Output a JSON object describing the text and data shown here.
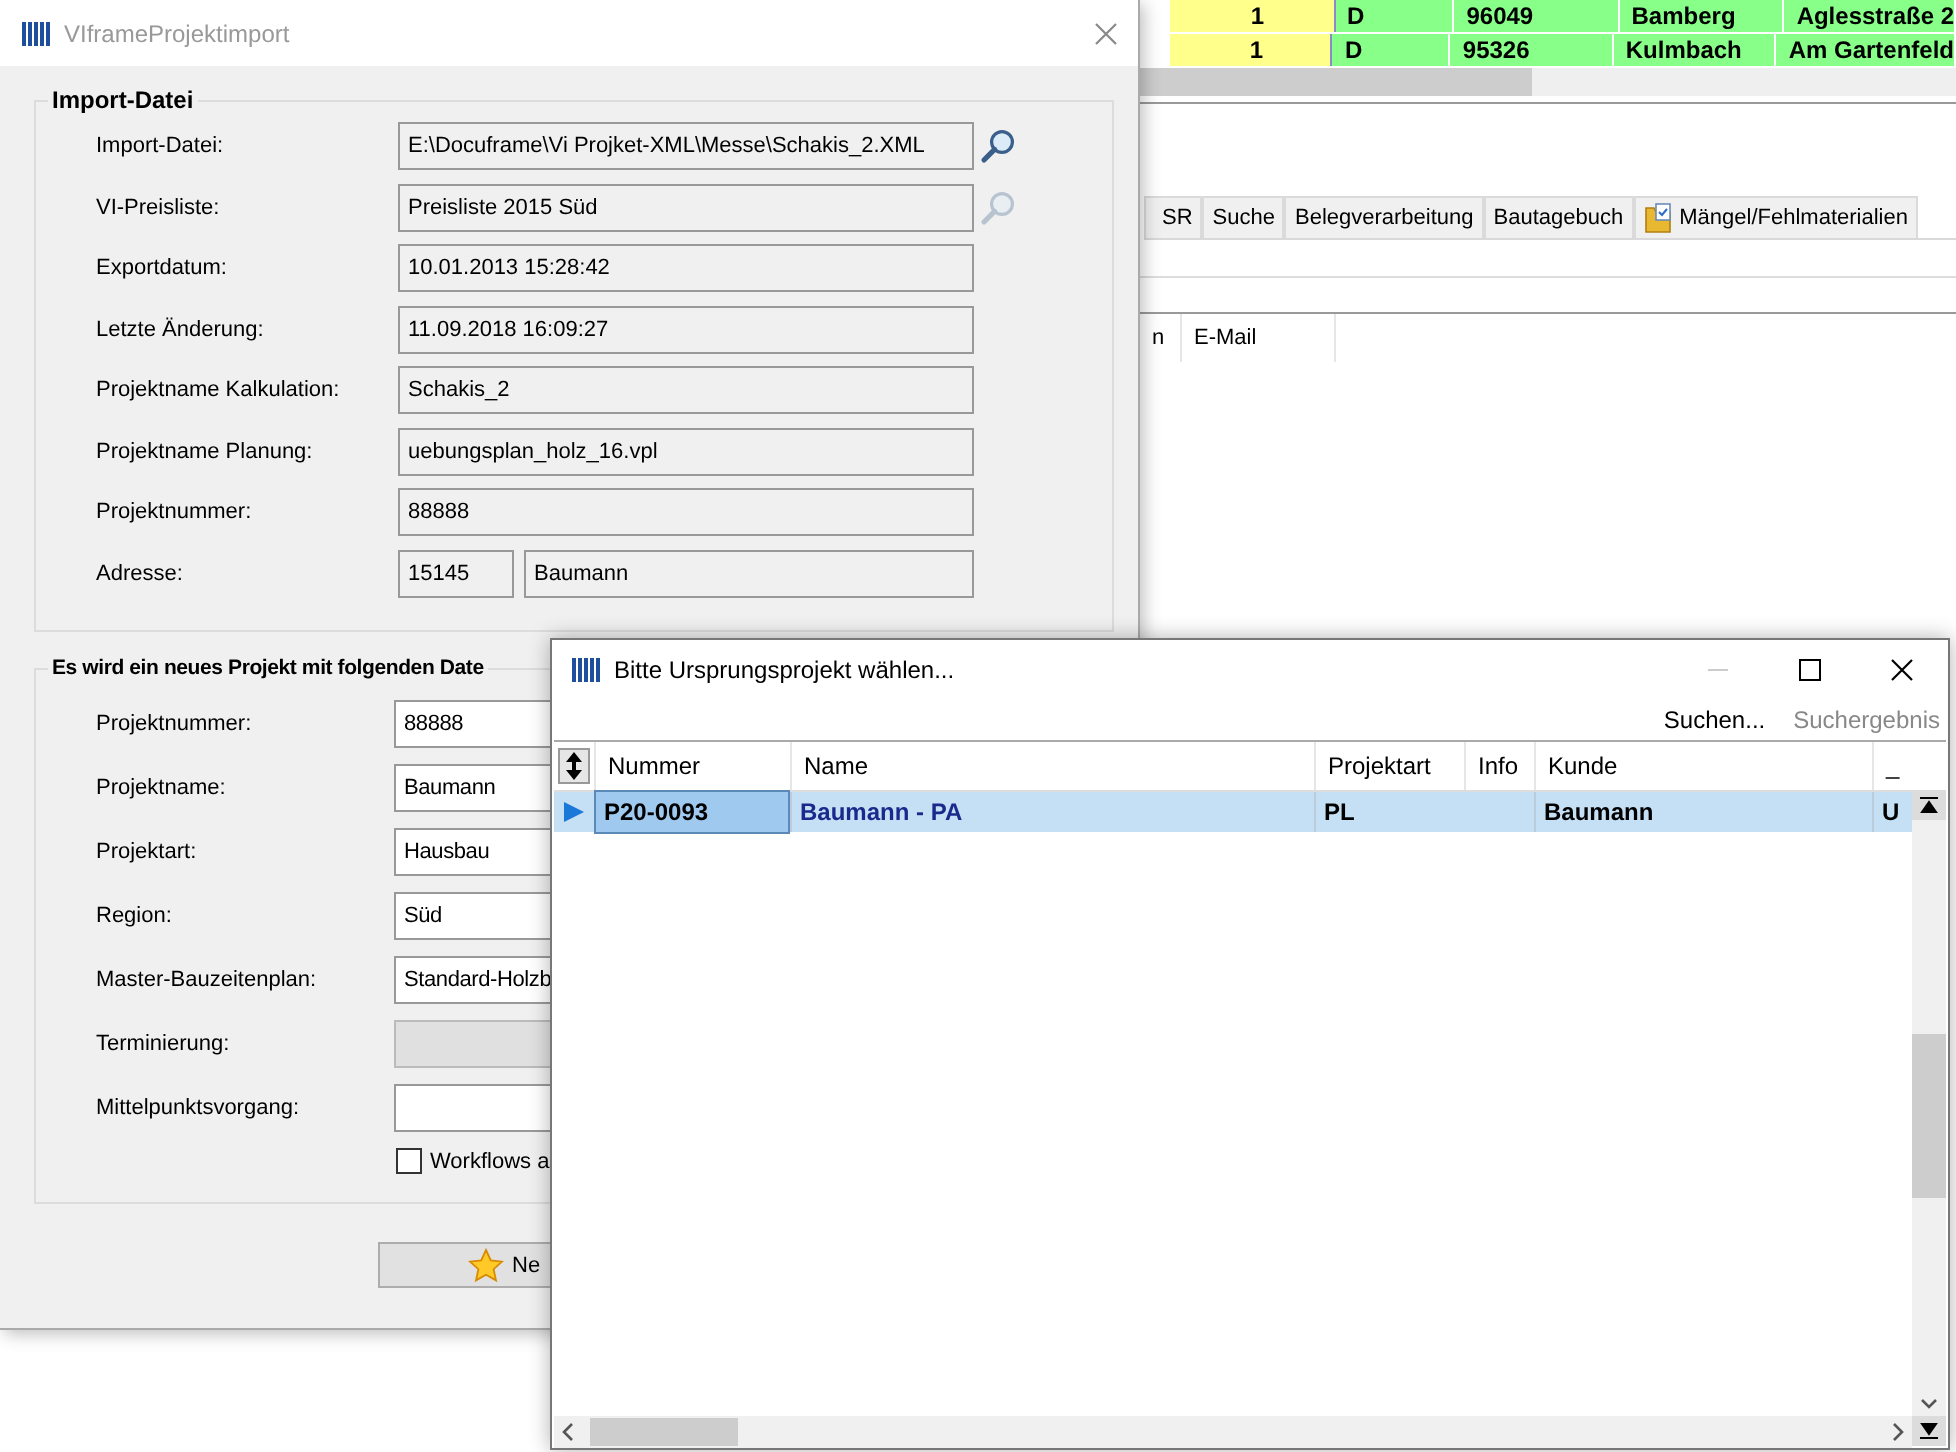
{
  "background_app": {
    "table_rows": [
      {
        "cells": [
          {
            "text": "1",
            "color": "#ffff8c"
          },
          {
            "text": "D",
            "color": "#88ff88"
          },
          {
            "text": "96049",
            "color": "#88ff88"
          },
          {
            "text": "Bamberg",
            "color": "#88ff88"
          },
          {
            "text": "Aglesstraße 2",
            "color": "#88ff88"
          }
        ]
      },
      {
        "cells": [
          {
            "text": "1",
            "color": "#ffff8c"
          },
          {
            "text": "D",
            "color": "#88ff88"
          },
          {
            "text": "95326",
            "color": "#88ff88"
          },
          {
            "text": "Kulmbach",
            "color": "#88ff88"
          },
          {
            "text": "Am Gartenfeld",
            "color": "#88ff88"
          }
        ]
      }
    ],
    "tabs": [
      {
        "label": "SR",
        "kind": "plain"
      },
      {
        "label": "Suche",
        "kind": "plain"
      },
      {
        "label": "Belegverarbeitung",
        "kind": "plain"
      },
      {
        "label": "Bautagebuch",
        "kind": "plain"
      },
      {
        "label": "Mängel/Fehlmaterialien",
        "kind": "icon"
      }
    ],
    "columns": [
      "n",
      "E-Mail"
    ]
  },
  "import_dialog": {
    "title": "VIframeProjektimport",
    "active": false,
    "section_1": {
      "title": "Import-Datei",
      "fields": [
        {
          "label": "Import-Datei:",
          "kind": "text",
          "value": "E:\\Docuframe\\Vi Projket-XML\\Messe\\Schakis_2.XML",
          "search": {
            "disabled": false
          }
        },
        {
          "label": "VI-Preisliste:",
          "kind": "text",
          "value": "Preisliste 2015 Süd",
          "search": {
            "disabled": true
          }
        },
        {
          "label": "Exportdatum:",
          "kind": "text",
          "value": "10.01.2013 15:28:42"
        },
        {
          "label": "Letzte Änderung:",
          "kind": "text",
          "value": "11.09.2018 16:09:27"
        },
        {
          "label": "Projektname Kalkulation:",
          "kind": "text",
          "value": "Schakis_2"
        },
        {
          "label": "Projektname Planung:",
          "kind": "text",
          "value": "uebungsplan_holz_16.vpl"
        },
        {
          "label": "Projektnummer:",
          "kind": "text",
          "value": "88888"
        },
        {
          "label": "Adresse:",
          "kind": "pair",
          "values": [
            "15145",
            "Baumann"
          ]
        }
      ]
    },
    "section_2": {
      "title": "Es wird ein neues Projekt mit folgenden Date",
      "fields": [
        {
          "label": "Projektnummer:",
          "value": "88888",
          "disabled": false
        },
        {
          "label": "Projektname:",
          "value": "Baumann",
          "disabled": false
        },
        {
          "label": "Projektart:",
          "value": "Hausbau",
          "disabled": false
        },
        {
          "label": "Region:",
          "value": "Süd",
          "disabled": false
        },
        {
          "label": "Master-Bauzeitenplan:",
          "value": "Standard-Holzb",
          "disabled": false
        },
        {
          "label": "Terminierung:",
          "disabled": true
        },
        {
          "label": "Mittelpunktsvorgang:",
          "disabled": false
        }
      ],
      "checkbox": {
        "label": "Workflows a",
        "checked": false
      }
    },
    "button": {
      "label": "Ne"
    }
  },
  "select_dialog": {
    "title": "Bitte Ursprungsprojekt wählen...",
    "active": true,
    "window_buttons": [
      {
        "kind": "minimize",
        "disabled": true
      },
      {
        "kind": "maximize",
        "disabled": false
      },
      {
        "kind": "close",
        "disabled": false
      }
    ],
    "toolbar": [
      {
        "label": "Suchen...",
        "disabled": false
      },
      {
        "label": "Suchergebnis",
        "disabled": true
      }
    ],
    "columns": [
      "Nummer",
      "Name",
      "Projektart",
      "Info",
      "Kunde",
      "_"
    ],
    "rows": [
      {
        "selected": true,
        "nummer": "P20-0093",
        "name": "Baumann - PA",
        "projektart": "PL",
        "kunde": "Baumann",
        "column_6": "U"
      }
    ]
  }
}
